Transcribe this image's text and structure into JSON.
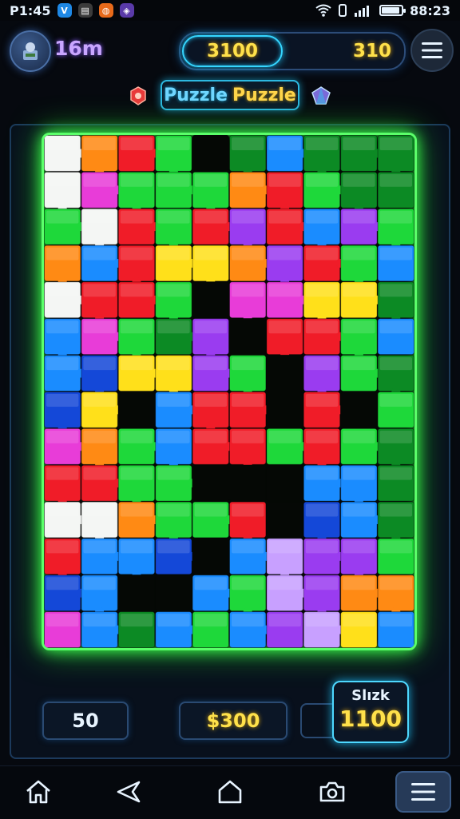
{
  "status_bar": {
    "time_left": "P1:45",
    "time_right": "88:23",
    "apps": [
      {
        "name": "messenger",
        "glyph": "V",
        "color": "#1e88e5"
      },
      {
        "name": "calendar",
        "glyph": "▤",
        "color": "#3b3b3b"
      },
      {
        "name": "game",
        "glyph": "◍",
        "color": "#e86a1a"
      },
      {
        "name": "gallery",
        "glyph": "◈",
        "color": "#5a3aa8"
      }
    ]
  },
  "hud": {
    "level": "16m",
    "score_left": "3100",
    "score_right": "310"
  },
  "title": {
    "part1": "Puzzle",
    "part2": "Puzzle"
  },
  "board": {
    "cols": 10,
    "rows": 14,
    "palette": {
      "R": "#f01c28",
      "G": "#1ed83a",
      "D": "#0c8a24",
      "B": "#1a8cff",
      "N": "#1448d8",
      "Y": "#ffe01a",
      "O": "#ff8a14",
      "P": "#9a3cf0",
      "M": "#e83cd8",
      "W": "#f4f6f4",
      "K": "#050805",
      "L": "#c8a0ff",
      "C": "#28b8f8"
    },
    "grid": [
      "WORGKDBDDD",
      "WMGGGORGDD",
      "GWRGRPRBPG",
      "OBRYYOPRGB",
      "WRRGKMMYYD",
      "BMGDPKRRGB",
      "BNYYPGKPGD",
      "NYKBRRKRKG",
      "MOGBRRGRGD",
      "RRGGKKKBBD",
      "WWOGGRKNBD",
      "RBBNKBLPPG",
      "NBKKBGLPOO",
      "MBDBGBPLYB"
    ]
  },
  "bottom": {
    "moves": "50",
    "coins": "$300",
    "best_label": "Slızk",
    "best_value": "1100"
  },
  "nav": [
    "home",
    "share",
    "house",
    "camera",
    "menu"
  ]
}
